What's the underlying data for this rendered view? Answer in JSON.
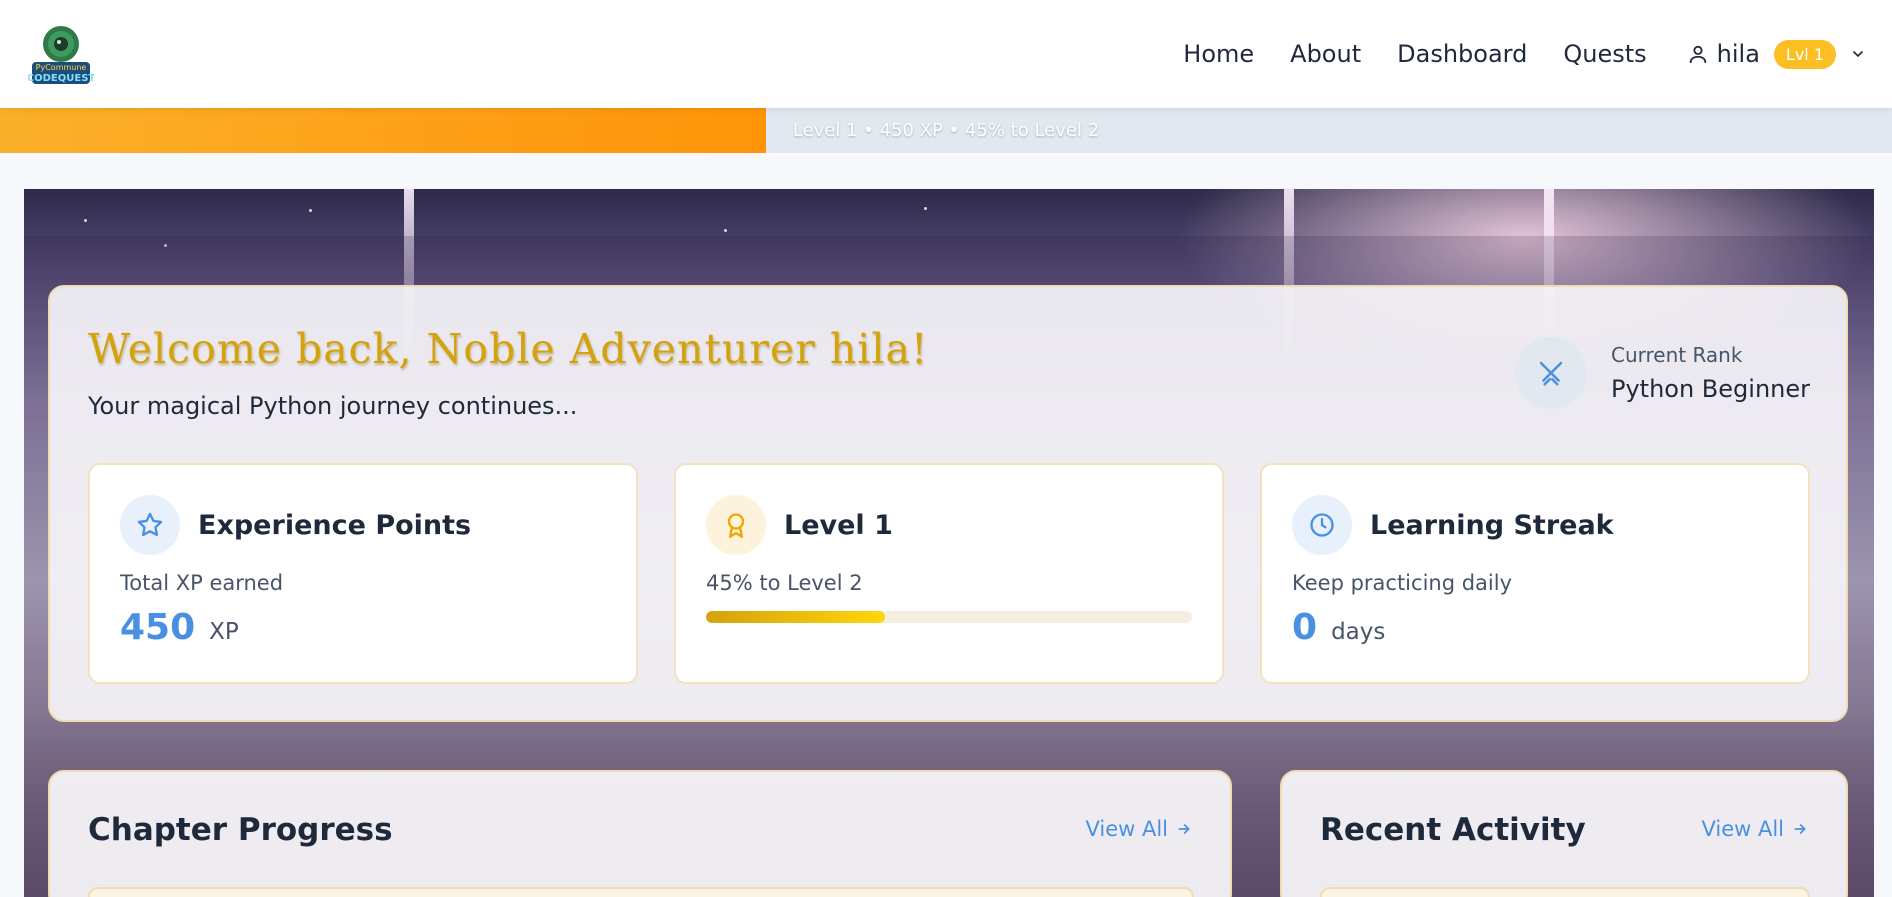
{
  "brand": {
    "logo_alt": "PyCommune CodeQuest",
    "logo_text_top": "PyCommune",
    "logo_text_bottom": "CODEQUEST"
  },
  "nav": {
    "links": [
      "Home",
      "About",
      "Dashboard",
      "Quests"
    ],
    "user": {
      "name": "hila",
      "level_badge": "Lvl 1"
    }
  },
  "xp_bar": {
    "text": "Level 1 • 450 XP • 45% to Level 2",
    "progress_fraction": 0.45
  },
  "welcome": {
    "title": "Welcome back, Noble Adventurer hila!",
    "subtitle": "Your magical Python journey continues...",
    "rank": {
      "label": "Current Rank",
      "value": "Python Beginner"
    }
  },
  "cards": {
    "xp": {
      "title": "Experience Points",
      "sub": "Total XP earned",
      "value": "450",
      "unit": "XP"
    },
    "level": {
      "title": "Level 1",
      "sub": "45% to Level 2",
      "progress_fraction": 0.45
    },
    "streak": {
      "title": "Learning Streak",
      "sub": "Keep practicing daily",
      "value": "0",
      "unit": "days"
    }
  },
  "panels": {
    "chapter": {
      "title": "Chapter Progress",
      "view_all": "View All"
    },
    "activity": {
      "title": "Recent Activity",
      "view_all": "View All"
    }
  },
  "colors": {
    "accent_blue": "#4a90e2",
    "gold": "#d4a20c",
    "orange": "#ff9408",
    "badge": "#fbbf24"
  },
  "icons": {
    "xp": "star-icon",
    "level": "award-icon",
    "streak": "clock-icon",
    "rank": "crossed-swords-icon",
    "user": "user-icon"
  }
}
